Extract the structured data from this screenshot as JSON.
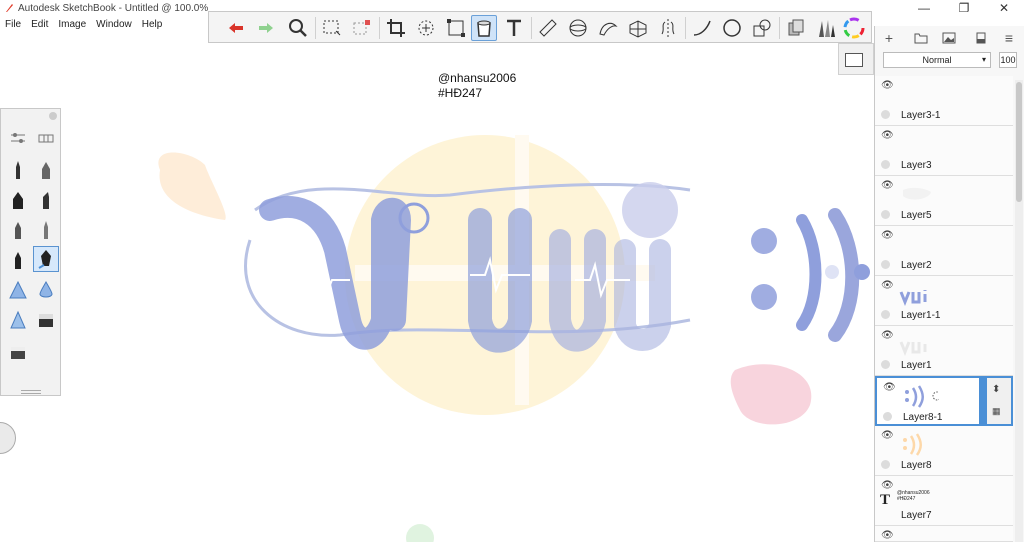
{
  "window": {
    "title": "Autodesk SketchBook - Untitled @ 100.0%",
    "min_icon": "minimize-icon",
    "max_icon": "maximize-icon",
    "close_icon": "close-icon"
  },
  "menu": [
    "File",
    "Edit",
    "Image",
    "Window",
    "Help"
  ],
  "toolbar": {
    "tools": [
      "undo-icon",
      "redo-icon",
      "zoom-icon",
      "select-icon",
      "lasso-select-icon",
      "crop-icon",
      "transform-icon",
      "distort-icon",
      "fill-icon",
      "text-icon",
      "ruler-icon",
      "ellipse-guide-icon",
      "french-curve-icon",
      "perspective-icon",
      "symmetry-icon",
      "stroke-icon",
      "circle-icon",
      "shape-icon",
      "copic-library-icon",
      "brush-library-icon",
      "color-wheel-icon"
    ]
  },
  "canvas": {
    "watermark_line1": "@nhansu2006",
    "watermark_line2": "#HĐ247",
    "colors": {
      "blue": "#8f9fdc",
      "pink": "#f6c9d4",
      "yellow": "#fde6a9",
      "outline": "#b8c2e4"
    }
  },
  "layer_panel": {
    "blend_mode": "Normal",
    "opacity": "100",
    "header_icons": [
      "add-layer-icon",
      "folder-icon",
      "image-icon",
      "clear-icon",
      "menu-icon"
    ],
    "layers": [
      {
        "name": "Layer3-1"
      },
      {
        "name": "Layer3"
      },
      {
        "name": "Layer5"
      },
      {
        "name": "Layer2"
      },
      {
        "name": "Layer1-1"
      },
      {
        "name": "Layer1"
      },
      {
        "name": "Layer8-1"
      },
      {
        "name": "Layer8"
      },
      {
        "name": "Layer7",
        "thumb_text_line1": "@nhansu2006",
        "thumb_text_line2": "#HĐ247"
      }
    ]
  }
}
